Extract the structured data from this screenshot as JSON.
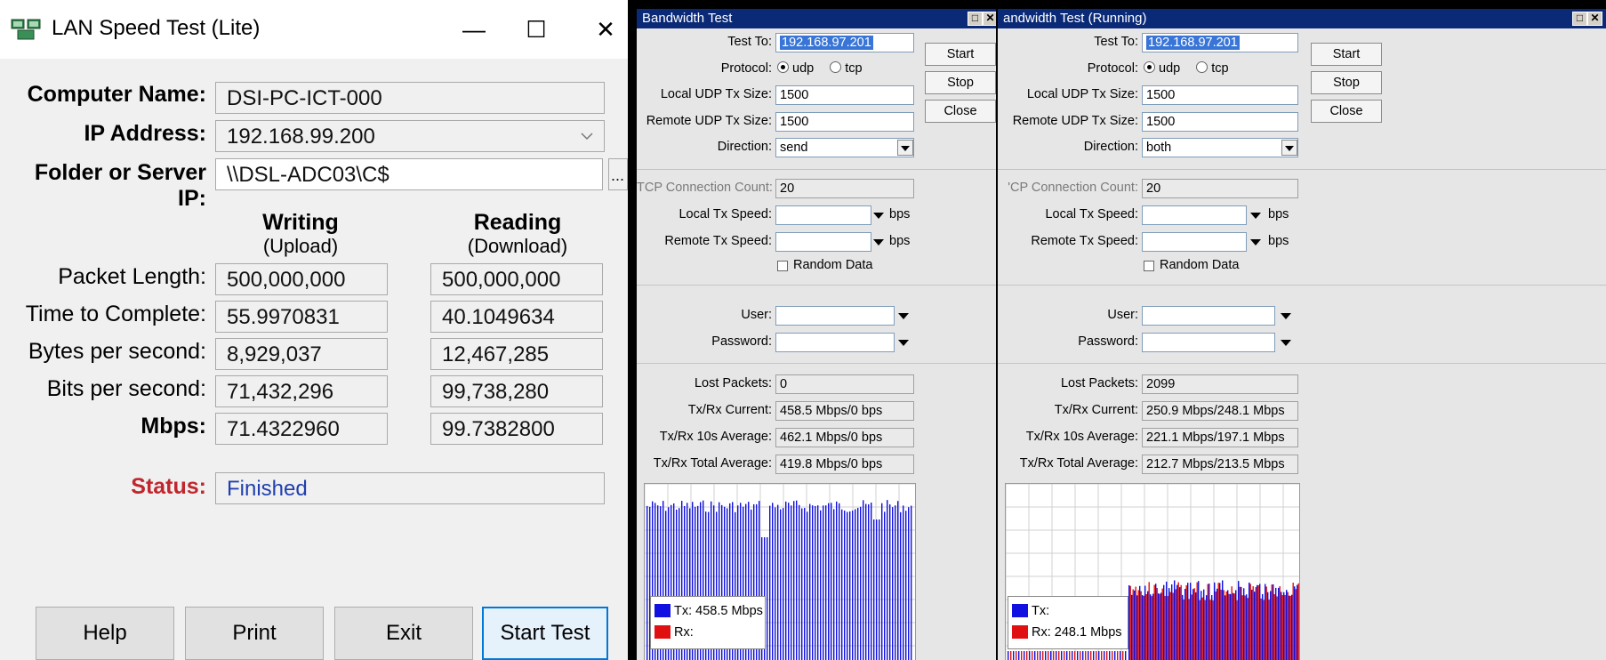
{
  "lan": {
    "title": "LAN Speed Test (Lite)",
    "minimize": "—",
    "maximize": "☐",
    "close": "✕",
    "computer_name_label": "Computer Name:",
    "computer_name": "DSI-PC-ICT-000",
    "ip_label": "IP Address:",
    "ip": "192.168.99.200",
    "folder_label": "Folder or Server IP:",
    "folder": "\\\\DSL-ADC03\\C$",
    "browse": "...",
    "writing": "Writing",
    "upload": "(Upload)",
    "reading": "Reading",
    "download": "(Download)",
    "rows": [
      {
        "label": "Packet Length:",
        "write": "500,000,000",
        "read": "500,000,000"
      },
      {
        "label": "Time to Complete:",
        "write": "55.9970831",
        "read": "40.1049634"
      },
      {
        "label": "Bytes per second:",
        "write": "8,929,037",
        "read": "12,467,285"
      },
      {
        "label": "Bits per second:",
        "write": "71,432,296",
        "read": "99,738,280"
      },
      {
        "label": "Mbps:",
        "write": "71.4322960",
        "read": "99.7382800"
      }
    ],
    "status_label": "Status:",
    "status": "Finished",
    "buttons": {
      "help": "Help",
      "print": "Print",
      "exit": "Exit",
      "start": "Start Test"
    },
    "colors": {
      "status_label": "#c0262d",
      "status_value": "#1f3fae",
      "primary_border": "#0078d7"
    }
  },
  "bw1": {
    "title": "Bandwidth Test",
    "test_to_label": "Test To:",
    "test_to": "192.168.97.201",
    "protocol_label": "Protocol:",
    "udp": "udp",
    "tcp": "tcp",
    "local_udp_label": "Local UDP Tx Size:",
    "local_udp": "1500",
    "remote_udp_label": "Remote UDP Tx Size:",
    "remote_udp": "1500",
    "direction_label": "Direction:",
    "direction": "send",
    "tcp_count_label": "TCP Connection Count:",
    "tcp_count": "20",
    "local_speed_label": "Local Tx Speed:",
    "remote_speed_label": "Remote Tx Speed:",
    "bps": "bps",
    "random_data": "Random Data",
    "user_label": "User:",
    "password_label": "Password:",
    "lost_label": "Lost Packets:",
    "lost": "0",
    "current_label": "Tx/Rx Current:",
    "current": "458.5 Mbps/0 bps",
    "avg10_label": "Tx/Rx 10s Average:",
    "avg10": "462.1 Mbps/0 bps",
    "total_label": "Tx/Rx Total Average:",
    "total": "419.8 Mbps/0 bps",
    "start": "Start",
    "stop": "Stop",
    "close": "Close",
    "legend_tx": "Tx:  458.5 Mbps",
    "legend_rx": "Rx:"
  },
  "bw2": {
    "title": "andwidth Test (Running)",
    "test_to_label": "Test To:",
    "test_to": "192.168.97.201",
    "protocol_label": "Protocol:",
    "udp": "udp",
    "tcp": "tcp",
    "local_udp_label": "Local UDP Tx Size:",
    "local_udp": "1500",
    "remote_udp_label": "Remote UDP Tx Size:",
    "remote_udp": "1500",
    "direction_label": "Direction:",
    "direction": "both",
    "tcp_count_label": "'CP Connection Count:",
    "tcp_count": "20",
    "local_speed_label": "Local Tx Speed:",
    "remote_speed_label": "Remote Tx Speed:",
    "bps": "bps",
    "random_data": "Random Data",
    "user_label": "User:",
    "password_label": "Password:",
    "lost_label": "Lost Packets:",
    "lost": "2099",
    "current_label": "Tx/Rx Current:",
    "current": "250.9 Mbps/248.1 Mbps",
    "avg10_label": "Tx/Rx 10s Average:",
    "avg10": "221.1 Mbps/197.1 Mbps",
    "total_label": "Tx/Rx Total Average:",
    "total": "212.7 Mbps/213.5 Mbps",
    "start": "Start",
    "stop": "Stop",
    "close": "Close",
    "legend_tx": "Tx:",
    "legend_rx": "Rx:  248.1 Mbps"
  },
  "colors": {
    "tx": "#1010e0",
    "rx": "#e01010",
    "titlebar": "#0a2a78",
    "selection": "#3875d7"
  }
}
